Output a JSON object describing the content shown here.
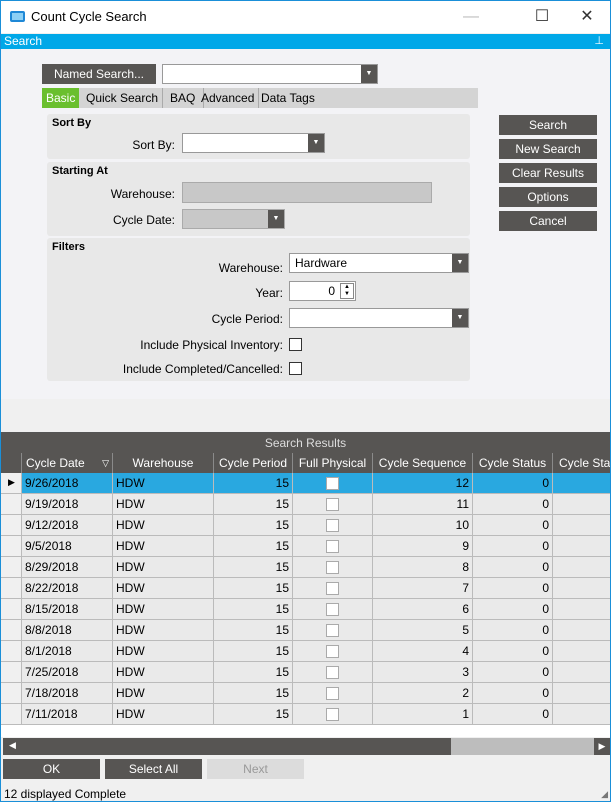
{
  "window": {
    "title": "Count Cycle Search",
    "minimize": "—",
    "maximize": "☐",
    "close": "✕"
  },
  "panel": {
    "title": "Search",
    "pin_icon": "pin-icon"
  },
  "named_search": {
    "button": "Named Search...",
    "value": ""
  },
  "tabs": [
    {
      "label": "Basic",
      "active": true
    },
    {
      "label": "Quick Search"
    },
    {
      "label": "BAQ"
    },
    {
      "label": "Advanced"
    },
    {
      "label": "Data Tags"
    }
  ],
  "sort_by": {
    "header": "Sort By",
    "label": "Sort By:",
    "value": ""
  },
  "starting_at": {
    "header": "Starting At",
    "warehouse_label": "Warehouse:",
    "warehouse_value": "",
    "cycle_date_label": "Cycle Date:",
    "cycle_date_value": ""
  },
  "filters": {
    "header": "Filters",
    "warehouse_label": "Warehouse:",
    "warehouse_value": "Hardware",
    "year_label": "Year:",
    "year_value": "0",
    "cycle_period_label": "Cycle Period:",
    "cycle_period_value": "",
    "physical_label": "Include Physical Inventory:",
    "physical_checked": false,
    "completed_label": "Include Completed/Cancelled:",
    "completed_checked": false
  },
  "actions": [
    "Search",
    "New Search",
    "Clear Results",
    "Options",
    "Cancel"
  ],
  "results": {
    "title": "Search Results",
    "columns": [
      "Cycle Date",
      "Warehouse",
      "Cycle Period",
      "Full Physical",
      "Cycle Sequence",
      "Cycle Status",
      "Cycle Stat"
    ],
    "rows": [
      [
        "9/26/2018",
        "HDW",
        "15",
        false,
        "12",
        "0"
      ],
      [
        "9/19/2018",
        "HDW",
        "15",
        false,
        "11",
        "0"
      ],
      [
        "9/12/2018",
        "HDW",
        "15",
        false,
        "10",
        "0"
      ],
      [
        "9/5/2018",
        "HDW",
        "15",
        false,
        "9",
        "0"
      ],
      [
        "8/29/2018",
        "HDW",
        "15",
        false,
        "8",
        "0"
      ],
      [
        "8/22/2018",
        "HDW",
        "15",
        false,
        "7",
        "0"
      ],
      [
        "8/15/2018",
        "HDW",
        "15",
        false,
        "6",
        "0"
      ],
      [
        "8/8/2018",
        "HDW",
        "15",
        false,
        "5",
        "0"
      ],
      [
        "8/1/2018",
        "HDW",
        "15",
        false,
        "4",
        "0"
      ],
      [
        "7/25/2018",
        "HDW",
        "15",
        false,
        "3",
        "0"
      ],
      [
        "7/18/2018",
        "HDW",
        "15",
        false,
        "2",
        "0"
      ],
      [
        "7/11/2018",
        "HDW",
        "15",
        false,
        "1",
        "0"
      ]
    ],
    "selected_row": 0
  },
  "footer": {
    "ok": "OK",
    "select_all": "Select All",
    "next": "Next",
    "status": "12 displayed Complete"
  },
  "colors": {
    "accent": "#00a8e8",
    "button": "#575553",
    "active_tab": "#6abf2e",
    "selected_row": "#29a8e0"
  }
}
